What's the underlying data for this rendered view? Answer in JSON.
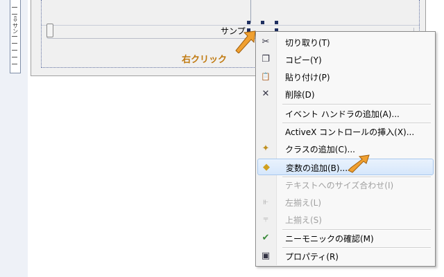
{
  "ruler": {
    "arrow_glyph": "⇩",
    "text": "サン"
  },
  "design": {
    "sample_label": "サンプ"
  },
  "annotation": {
    "right_click": "右クリック"
  },
  "context_menu": {
    "items": [
      {
        "label": "切り取り(T)",
        "icon": "scissors-icon",
        "glyph": "✂",
        "enabled": true
      },
      {
        "label": "コピー(Y)",
        "icon": "copy-icon",
        "glyph": "❐",
        "enabled": true
      },
      {
        "label": "貼り付け(P)",
        "icon": "paste-icon",
        "glyph": "📋",
        "enabled": true
      },
      {
        "label": "削除(D)",
        "icon": "delete-icon",
        "glyph": "✕",
        "enabled": true
      },
      {
        "label": "イベント ハンドラの追加(A)...",
        "icon": "",
        "glyph": "",
        "enabled": true
      },
      {
        "label": "ActiveX コントロールの挿入(X)...",
        "icon": "",
        "glyph": "",
        "enabled": true
      },
      {
        "label": "クラスの追加(C)...",
        "icon": "add-class-icon",
        "glyph": "✦",
        "enabled": true
      },
      {
        "label": "変数の追加(B)...",
        "icon": "add-variable-icon",
        "glyph": "◆",
        "enabled": true,
        "highlighted": true
      },
      {
        "label": "テキストへのサイズ合わせ(I)",
        "icon": "",
        "glyph": "",
        "enabled": false
      },
      {
        "label": "左揃え(L)",
        "icon": "align-left-icon",
        "glyph": "⫦",
        "enabled": false
      },
      {
        "label": "上揃え(S)",
        "icon": "align-top-icon",
        "glyph": "⫧",
        "enabled": false
      },
      {
        "label": "ニーモニックの確認(M)",
        "icon": "check-mnemonic-icon",
        "glyph": "✔",
        "enabled": true
      },
      {
        "label": "プロパティ(R)",
        "icon": "properties-icon",
        "glyph": "▣",
        "enabled": true
      }
    ]
  },
  "colors": {
    "annotation_orange": "#c07a10",
    "arrow_fill": "#f0a030"
  }
}
